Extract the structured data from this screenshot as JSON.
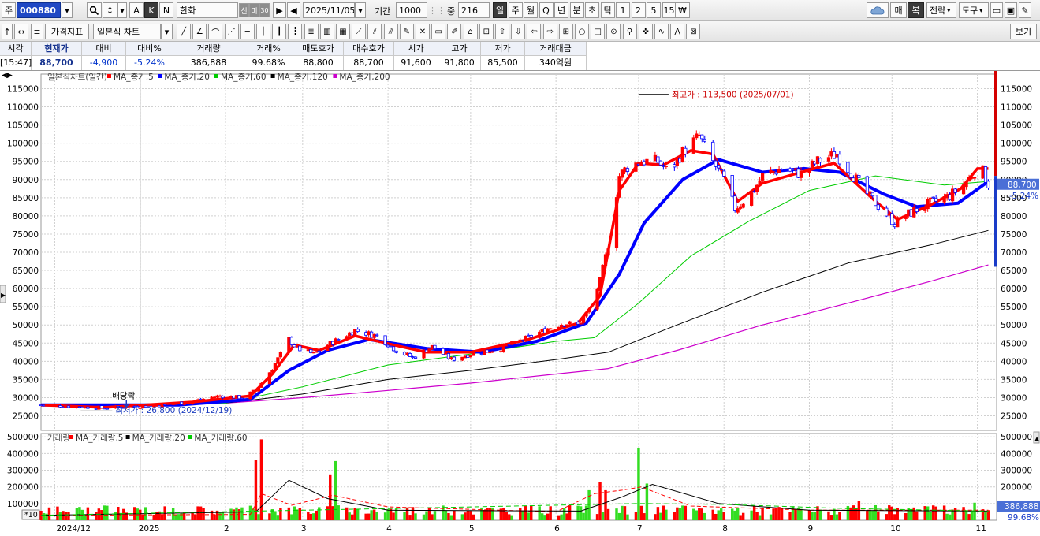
{
  "toolbar1": {
    "period_prefix": "주",
    "stock_code": "000880",
    "btn_a": "A",
    "btn_k": "K",
    "btn_n": "N",
    "stock_name": "한화",
    "badge1": "신",
    "badge2": "미",
    "badge3": "30",
    "date": "2025/11/05",
    "range_label": "기간",
    "range_value": "1000",
    "count_label": "중",
    "count_value": "216",
    "periods": [
      "일",
      "주",
      "월",
      "Q",
      "년",
      "분",
      "초",
      "틱",
      "1",
      "2",
      "5",
      "15"
    ],
    "active_period": "일",
    "right_buttons": [
      "매",
      "복",
      "전략",
      "도구"
    ]
  },
  "toolbar2": {
    "indicator_label": "가격지표",
    "chart_type": "일본식 차트",
    "view_button": "보기"
  },
  "quote": {
    "headers": [
      "시각",
      "현재가",
      "대비",
      "대비%",
      "거래량",
      "거래%",
      "매도호가",
      "매수호가",
      "시가",
      "고가",
      "저가",
      "거래대금"
    ],
    "values": [
      "[15:47]",
      "88,700",
      "-4,900",
      "-5.24%",
      "386,888",
      "99.68%",
      "88,800",
      "88,700",
      "91,600",
      "91,800",
      "85,500",
      "340억원"
    ]
  },
  "legend_price": {
    "title": "일본식차트(일간)",
    "items": [
      {
        "label": "MA_종가,5",
        "color": "#ff0000"
      },
      {
        "label": "MA_종가,20",
        "color": "#0000ff"
      },
      {
        "label": "MA_종가,60",
        "color": "#00cc00"
      },
      {
        "label": "MA_종가,120",
        "color": "#000000"
      },
      {
        "label": "MA_종가,200",
        "color": "#cc00cc"
      }
    ]
  },
  "legend_volume": {
    "title": "거래량",
    "items": [
      {
        "label": "MA_거래량,5",
        "color": "#ff0000"
      },
      {
        "label": "MA_거래량,20",
        "color": "#000000"
      },
      {
        "label": "MA_거래량,60",
        "color": "#00cc00"
      }
    ]
  },
  "annotations": {
    "high": "최고가 : 113,500 (2025/07/01)",
    "low": "최저가 : 26,800 (2024/12/19)",
    "dividend": "배당락"
  },
  "badges": {
    "price": "88,700",
    "change": "-5.24%",
    "volume": "386,888",
    "volume_pct": "99.68%",
    "multiplier": "*10"
  },
  "chart_data": [
    {
      "type": "candlestick",
      "title": "일본식차트(일간)",
      "y_axis_ticks": [
        25000,
        30000,
        35000,
        40000,
        45000,
        50000,
        55000,
        60000,
        65000,
        70000,
        75000,
        80000,
        85000,
        90000,
        95000,
        100000,
        105000,
        110000,
        115000
      ],
      "ylim": [
        21000,
        119000
      ],
      "x_tick_labels": [
        "2024/12",
        "2025",
        "2",
        "3",
        "4",
        "5",
        "6",
        "7",
        "8",
        "9",
        "10",
        "11"
      ],
      "x_tick_dates": [
        "2024-12-01",
        "2025-01-01",
        "2025-02-01",
        "2025-03-01",
        "2025-04-01",
        "2025-05-01",
        "2025-06-01",
        "2025-07-01",
        "2025-08-01",
        "2025-09-01",
        "2025-10-01",
        "2025-11-01"
      ],
      "x_range": [
        "2024-11-26",
        "2025-11-08"
      ],
      "grid": true,
      "legend": "top-left",
      "close_path": [
        [
          "2024-11-26",
          28000
        ],
        [
          "2024-12-10",
          27500
        ],
        [
          "2024-12-19",
          27200
        ],
        [
          "2025-01-10",
          28000
        ],
        [
          "2025-01-20",
          29000
        ],
        [
          "2025-01-30",
          30500
        ],
        [
          "2025-02-07",
          30000
        ],
        [
          "2025-02-12",
          32000
        ],
        [
          "2025-02-18",
          38000
        ],
        [
          "2025-02-24",
          46000
        ],
        [
          "2025-02-27",
          43500
        ],
        [
          "2025-03-05",
          42000
        ],
        [
          "2025-03-10",
          44500
        ],
        [
          "2025-03-20",
          48500
        ],
        [
          "2025-03-28",
          47000
        ],
        [
          "2025-04-04",
          43000
        ],
        [
          "2025-04-10",
          41000
        ],
        [
          "2025-04-17",
          44000
        ],
        [
          "2025-04-24",
          40500
        ],
        [
          "2025-05-01",
          42000
        ],
        [
          "2025-05-12",
          43500
        ],
        [
          "2025-05-22",
          46500
        ],
        [
          "2025-05-29",
          49000
        ],
        [
          "2025-06-04",
          50500
        ],
        [
          "2025-06-09",
          50000
        ],
        [
          "2025-06-13",
          54000
        ],
        [
          "2025-06-17",
          62000
        ],
        [
          "2025-06-20",
          72000
        ],
        [
          "2025-06-24",
          91000
        ],
        [
          "2025-06-27",
          93500
        ],
        [
          "2025-07-02",
          95000
        ],
        [
          "2025-07-08",
          95000
        ],
        [
          "2025-07-12",
          92000
        ],
        [
          "2025-07-17",
          97500
        ],
        [
          "2025-07-23",
          102000
        ],
        [
          "2025-07-27",
          96000
        ],
        [
          "2025-08-01",
          90000
        ],
        [
          "2025-08-05",
          82000
        ],
        [
          "2025-08-11",
          86000
        ],
        [
          "2025-08-15",
          91000
        ],
        [
          "2025-08-22",
          93000
        ],
        [
          "2025-08-29",
          91500
        ],
        [
          "2025-09-04",
          95000
        ],
        [
          "2025-09-11",
          97000
        ],
        [
          "2025-09-17",
          91000
        ],
        [
          "2025-09-22",
          86000
        ],
        [
          "2025-09-27",
          82000
        ],
        [
          "2025-10-02",
          78000
        ],
        [
          "2025-10-07",
          80500
        ],
        [
          "2025-10-13",
          83000
        ],
        [
          "2025-10-17",
          84000
        ],
        [
          "2025-10-22",
          85500
        ],
        [
          "2025-10-27",
          88500
        ],
        [
          "2025-11-02",
          94000
        ],
        [
          "2025-11-05",
          88700
        ]
      ],
      "ma_series": [
        {
          "name": "MA_종가,5",
          "color": "#ff0000",
          "points": [
            [
              "2024-11-26",
              28000
            ],
            [
              "2024-12-19",
              27300
            ],
            [
              "2025-01-20",
              28800
            ],
            [
              "2025-02-10",
              30500
            ],
            [
              "2025-02-18",
              36500
            ],
            [
              "2025-02-26",
              44500
            ],
            [
              "2025-03-07",
              43000
            ],
            [
              "2025-03-20",
              47000
            ],
            [
              "2025-04-03",
              44500
            ],
            [
              "2025-04-15",
              42500
            ],
            [
              "2025-05-01",
              42500
            ],
            [
              "2025-05-22",
              46000
            ],
            [
              "2025-06-09",
              50500
            ],
            [
              "2025-06-17",
              58000
            ],
            [
              "2025-06-24",
              87000
            ],
            [
              "2025-07-01",
              94500
            ],
            [
              "2025-07-10",
              94000
            ],
            [
              "2025-07-20",
              98000
            ],
            [
              "2025-07-28",
              97000
            ],
            [
              "2025-08-06",
              84000
            ],
            [
              "2025-08-15",
              89000
            ],
            [
              "2025-08-29",
              92000
            ],
            [
              "2025-09-10",
              94500
            ],
            [
              "2025-09-25",
              84000
            ],
            [
              "2025-10-03",
              79000
            ],
            [
              "2025-10-15",
              83000
            ],
            [
              "2025-10-26",
              87500
            ],
            [
              "2025-11-01",
              93000
            ],
            [
              "2025-11-05",
              93000
            ]
          ]
        },
        {
          "name": "MA_종가,20",
          "color": "#0000ff",
          "points": [
            [
              "2024-11-26",
              28000
            ],
            [
              "2025-01-15",
              28000
            ],
            [
              "2025-02-10",
              29500
            ],
            [
              "2025-02-24",
              37500
            ],
            [
              "2025-03-10",
              43000
            ],
            [
              "2025-03-25",
              46000
            ],
            [
              "2025-04-15",
              43500
            ],
            [
              "2025-05-05",
              42500
            ],
            [
              "2025-05-25",
              45500
            ],
            [
              "2025-06-12",
              50500
            ],
            [
              "2025-06-24",
              64000
            ],
            [
              "2025-07-03",
              78000
            ],
            [
              "2025-07-17",
              90000
            ],
            [
              "2025-07-30",
              95500
            ],
            [
              "2025-08-15",
              92000
            ],
            [
              "2025-08-30",
              93000
            ],
            [
              "2025-09-12",
              92000
            ],
            [
              "2025-09-28",
              86000
            ],
            [
              "2025-10-10",
              82500
            ],
            [
              "2025-10-25",
              83500
            ],
            [
              "2025-11-05",
              89500
            ]
          ]
        },
        {
          "name": "MA_종가,60",
          "color": "#00cc00",
          "points": [
            [
              "2024-11-26",
              28000
            ],
            [
              "2025-02-01",
              28500
            ],
            [
              "2025-03-01",
              33000
            ],
            [
              "2025-04-01",
              39000
            ],
            [
              "2025-05-01",
              42000
            ],
            [
              "2025-06-01",
              45500
            ],
            [
              "2025-06-15",
              46500
            ],
            [
              "2025-07-01",
              56000
            ],
            [
              "2025-07-20",
              69000
            ],
            [
              "2025-08-10",
              78500
            ],
            [
              "2025-09-01",
              87000
            ],
            [
              "2025-09-25",
              91000
            ],
            [
              "2025-10-20",
              88500
            ],
            [
              "2025-11-05",
              89500
            ]
          ]
        },
        {
          "name": "MA_종가,120",
          "color": "#000000",
          "points": [
            [
              "2025-02-01",
              28500
            ],
            [
              "2025-03-01",
              31000
            ],
            [
              "2025-04-01",
              35000
            ],
            [
              "2025-05-01",
              37500
            ],
            [
              "2025-06-01",
              40500
            ],
            [
              "2025-06-20",
              42500
            ],
            [
              "2025-07-15",
              50000
            ],
            [
              "2025-08-15",
              59000
            ],
            [
              "2025-09-15",
              67000
            ],
            [
              "2025-10-15",
              72000
            ],
            [
              "2025-11-05",
              76000
            ]
          ]
        },
        {
          "name": "MA_종가,200",
          "color": "#cc00cc",
          "points": [
            [
              "2025-02-01",
              28500
            ],
            [
              "2025-03-01",
              30000
            ],
            [
              "2025-04-01",
              32000
            ],
            [
              "2025-05-01",
              34000
            ],
            [
              "2025-06-01",
              36500
            ],
            [
              "2025-06-20",
              38000
            ],
            [
              "2025-07-15",
              43000
            ],
            [
              "2025-08-15",
              50000
            ],
            [
              "2025-09-15",
              56000
            ],
            [
              "2025-10-15",
              62000
            ],
            [
              "2025-11-05",
              66500
            ]
          ]
        }
      ]
    },
    {
      "type": "bar",
      "title": "거래량",
      "y_axis_ticks": [
        100000,
        200000,
        300000,
        400000,
        500000
      ],
      "ylim": [
        0,
        520000
      ],
      "x_range": [
        "2024-11-26",
        "2025-11-08"
      ],
      "notable_volumes": [
        [
          "2025-02-12",
          360000
        ],
        [
          "2025-02-14",
          485000
        ],
        [
          "2025-03-11",
          275000
        ],
        [
          "2025-03-13",
          355000
        ],
        [
          "2025-06-13",
          180000
        ],
        [
          "2025-06-17",
          230000
        ],
        [
          "2025-06-19",
          180000
        ],
        [
          "2025-06-21",
          270000
        ],
        [
          "2025-07-01",
          435000
        ],
        [
          "2025-07-04",
          220000
        ],
        [
          "2025-09-19",
          115000
        ],
        [
          "2025-10-31",
          105000
        ],
        [
          "2025-11-05",
          60000
        ]
      ],
      "ma_series": [
        {
          "name": "MA_거래량,5",
          "color": "#ff0000",
          "points": [
            [
              "2024-11-26",
              30000
            ],
            [
              "2025-02-10",
              35000
            ],
            [
              "2025-02-14",
              160000
            ],
            [
              "2025-02-25",
              90000
            ],
            [
              "2025-03-12",
              150000
            ],
            [
              "2025-04-01",
              80000
            ],
            [
              "2025-06-01",
              50000
            ],
            [
              "2025-06-15",
              160000
            ],
            [
              "2025-06-25",
              180000
            ],
            [
              "2025-07-02",
              200000
            ],
            [
              "2025-07-20",
              85000
            ],
            [
              "2025-09-01",
              60000
            ],
            [
              "2025-11-05",
              60000
            ]
          ]
        },
        {
          "name": "MA_거래량,20",
          "color": "#000000",
          "points": [
            [
              "2024-11-26",
              30000
            ],
            [
              "2025-02-12",
              50000
            ],
            [
              "2025-02-24",
              240000
            ],
            [
              "2025-03-10",
              130000
            ],
            [
              "2025-04-01",
              60000
            ],
            [
              "2025-06-10",
              55000
            ],
            [
              "2025-06-25",
              140000
            ],
            [
              "2025-07-06",
              215000
            ],
            [
              "2025-07-30",
              100000
            ],
            [
              "2025-09-01",
              60000
            ],
            [
              "2025-11-05",
              55000
            ]
          ]
        },
        {
          "name": "MA_거래량,60",
          "color": "#00cc00",
          "points": [
            [
              "2024-11-26",
              30000
            ],
            [
              "2025-03-01",
              60000
            ],
            [
              "2025-05-01",
              80000
            ],
            [
              "2025-07-01",
              100000
            ],
            [
              "2025-08-01",
              95000
            ],
            [
              "2025-09-15",
              70000
            ],
            [
              "2025-11-05",
              55000
            ]
          ]
        }
      ]
    }
  ]
}
